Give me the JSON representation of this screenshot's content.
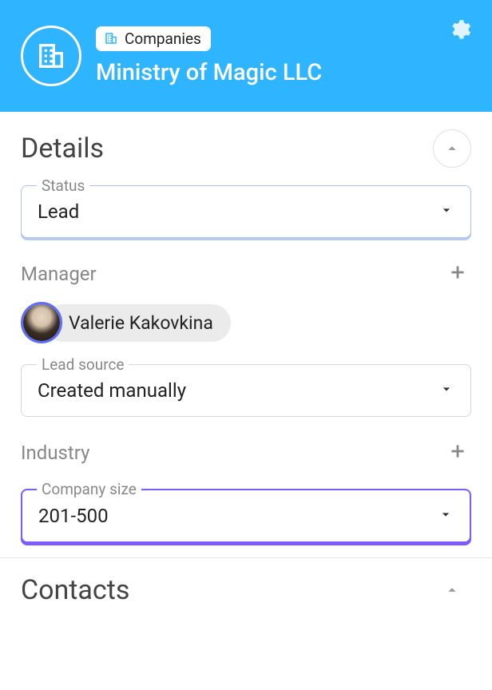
{
  "header": {
    "breadcrumb": "Companies",
    "title": "Ministry of Magic LLC"
  },
  "details": {
    "section_title": "Details",
    "status": {
      "label": "Status",
      "value": "Lead"
    },
    "manager": {
      "label": "Manager",
      "name": "Valerie Kakovkina"
    },
    "lead_source": {
      "label": "Lead source",
      "value": "Created manually"
    },
    "industry": {
      "label": "Industry"
    },
    "company_size": {
      "label": "Company size",
      "value": "201-500"
    }
  },
  "contacts": {
    "section_title": "Contacts"
  }
}
